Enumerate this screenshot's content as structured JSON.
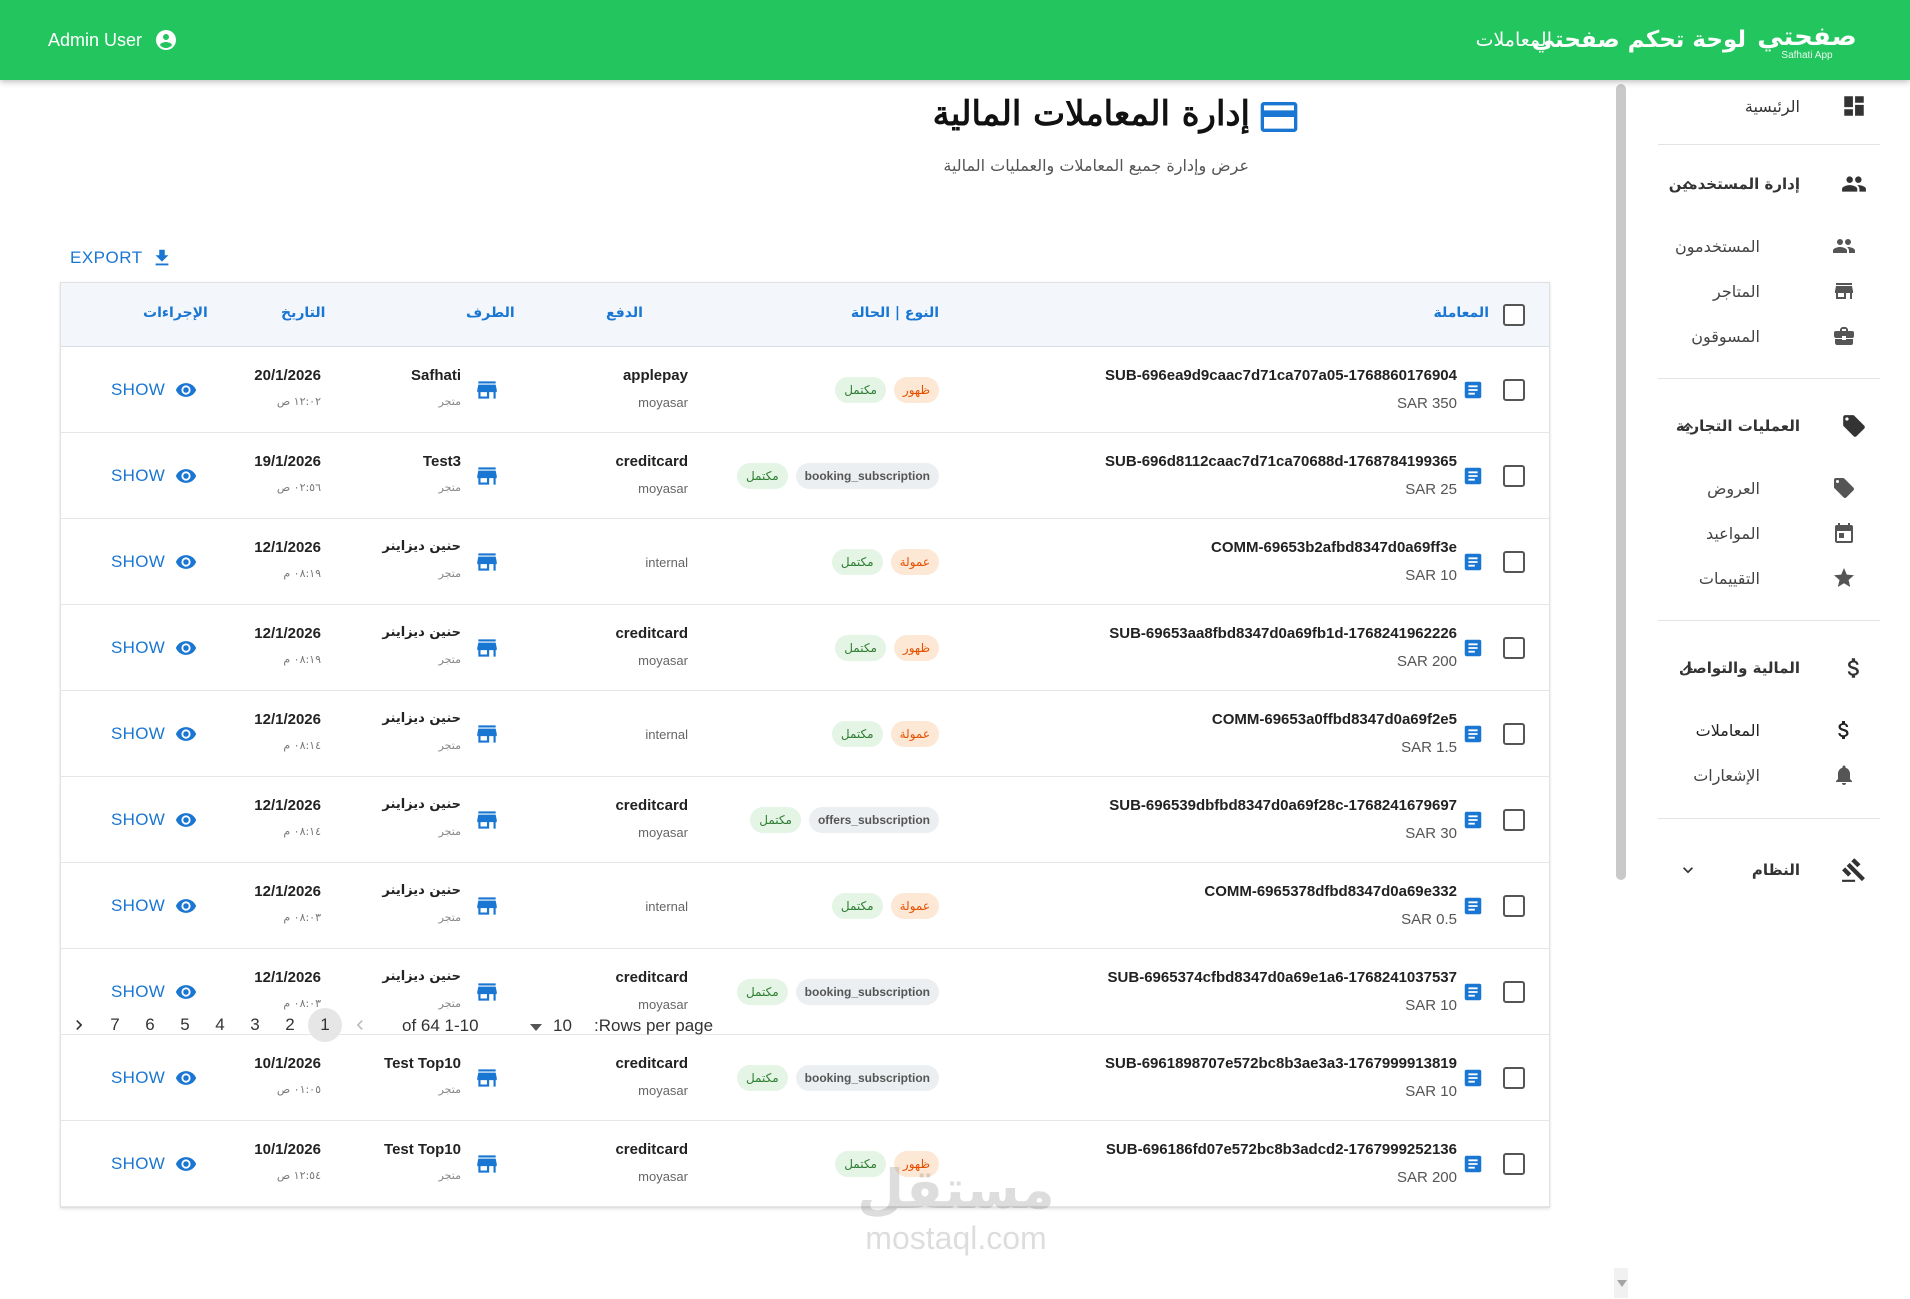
{
  "header": {
    "user_name": "Admin User",
    "app_title": "لوحة تحكم صفحتي",
    "nav_transactions": "المعاملات",
    "logo_mark": "صفحتي",
    "logo_sub": "Safhati App",
    "accent_color": "#22c55e"
  },
  "sidebar": {
    "home": "الرئيسية",
    "users_group": "إدارة المستخدمين",
    "users": "المستخدمون",
    "stores": "المتاجر",
    "marketers": "المسوقون",
    "business_group": "العمليات التجارية",
    "offers": "العروض",
    "appointments": "المواعيد",
    "ratings": "التقييمات",
    "finance_group": "المالية والتواصل",
    "transactions": "المعاملات",
    "notifications": "الإشعارات",
    "system_group": "النظام"
  },
  "page": {
    "title": "إدارة المعاملات المالية",
    "subtitle": "عرض وإدارة جميع المعاملات والعمليات المالية",
    "export_label": "EXPORT"
  },
  "table": {
    "headers": {
      "transaction": "المعاملة",
      "type_status": "النوع | الحالة",
      "payment": "الدفع",
      "party": "الطرف",
      "date": "التاريخ",
      "actions": "الإجراءات"
    },
    "show_label": "SHOW",
    "rows": [
      {
        "id": "SUB-696ea9d9caac7d71ca707a05-1768860176904",
        "amount": "SAR 350",
        "type": "ظهور",
        "type_style": "orange",
        "status": "مكتمل",
        "pay_method": "applepay",
        "pay_provider": "moyasar",
        "party": "Safhati",
        "party_type": "متجر",
        "date": "20/1/2026",
        "time": "١٢:٠٢ ص"
      },
      {
        "id": "SUB-696d8112caac7d71ca70688d-1768784199365",
        "amount": "SAR 25",
        "type": "booking_subscription",
        "type_style": "grey",
        "status": "مكتمل",
        "pay_method": "creditcard",
        "pay_provider": "moyasar",
        "party": "Test3",
        "party_type": "متجر",
        "date": "19/1/2026",
        "time": "٠٢:٥٦ ص"
      },
      {
        "id": "COMM-69653b2afbd8347d0a69ff3e",
        "amount": "SAR 10",
        "type": "عمولة",
        "type_style": "orange",
        "status": "مكتمل",
        "pay_method": "",
        "pay_provider": "internal",
        "party": "حنين ديزاينر",
        "party_type": "متجر",
        "date": "12/1/2026",
        "time": "٠٨:١٩ م"
      },
      {
        "id": "SUB-69653aa8fbd8347d0a69fb1d-1768241962226",
        "amount": "SAR 200",
        "type": "ظهور",
        "type_style": "orange",
        "status": "مكتمل",
        "pay_method": "creditcard",
        "pay_provider": "moyasar",
        "party": "حنين ديزاينر",
        "party_type": "متجر",
        "date": "12/1/2026",
        "time": "٠٨:١٩ م"
      },
      {
        "id": "COMM-69653a0ffbd8347d0a69f2e5",
        "amount": "SAR 1.5",
        "type": "عمولة",
        "type_style": "orange",
        "status": "مكتمل",
        "pay_method": "",
        "pay_provider": "internal",
        "party": "حنين ديزاينر",
        "party_type": "متجر",
        "date": "12/1/2026",
        "time": "٠٨:١٤ م"
      },
      {
        "id": "SUB-696539dbfbd8347d0a69f28c-1768241679697",
        "amount": "SAR 30",
        "type": "offers_subscription",
        "type_style": "grey",
        "status": "مكتمل",
        "pay_method": "creditcard",
        "pay_provider": "moyasar",
        "party": "حنين ديزاينر",
        "party_type": "متجر",
        "date": "12/1/2026",
        "time": "٠٨:١٤ م"
      },
      {
        "id": "COMM-6965378dfbd8347d0a69e332",
        "amount": "SAR 0.5",
        "type": "عمولة",
        "type_style": "orange",
        "status": "مكتمل",
        "pay_method": "",
        "pay_provider": "internal",
        "party": "حنين ديزاينر",
        "party_type": "متجر",
        "date": "12/1/2026",
        "time": "٠٨:٠٣ م"
      },
      {
        "id": "SUB-6965374cfbd8347d0a69e1a6-1768241037537",
        "amount": "SAR 10",
        "type": "booking_subscription",
        "type_style": "grey",
        "status": "مكتمل",
        "pay_method": "creditcard",
        "pay_provider": "moyasar",
        "party": "حنين ديزاينر",
        "party_type": "متجر",
        "date": "12/1/2026",
        "time": "٠٨:٠٣ م"
      },
      {
        "id": "SUB-6961898707e572bc8b3ae3a3-1767999913819",
        "amount": "SAR 10",
        "type": "booking_subscription",
        "type_style": "grey",
        "status": "مكتمل",
        "pay_method": "creditcard",
        "pay_provider": "moyasar",
        "party": "Test Top10",
        "party_type": "متجر",
        "date": "10/1/2026",
        "time": "٠١:٠٥ ص"
      },
      {
        "id": "SUB-696186fd07e572bc8b3adcd2-1767999252136",
        "amount": "SAR 200",
        "type": "ظهور",
        "type_style": "orange",
        "status": "مكتمل",
        "pay_method": "creditcard",
        "pay_provider": "moyasar",
        "party": "Test Top10",
        "party_type": "متجر",
        "date": "10/1/2026",
        "time": "١٢:٥٤ ص"
      }
    ]
  },
  "pagination": {
    "rows_per_page_label": ":Rows per page",
    "rows_per_page": "10",
    "range": "of 64 1-10",
    "pages": [
      "1",
      "2",
      "3",
      "4",
      "5",
      "6",
      "7"
    ],
    "current_page": "1"
  },
  "watermark": {
    "line1": "مستقل",
    "line2": "mostaql.com"
  }
}
